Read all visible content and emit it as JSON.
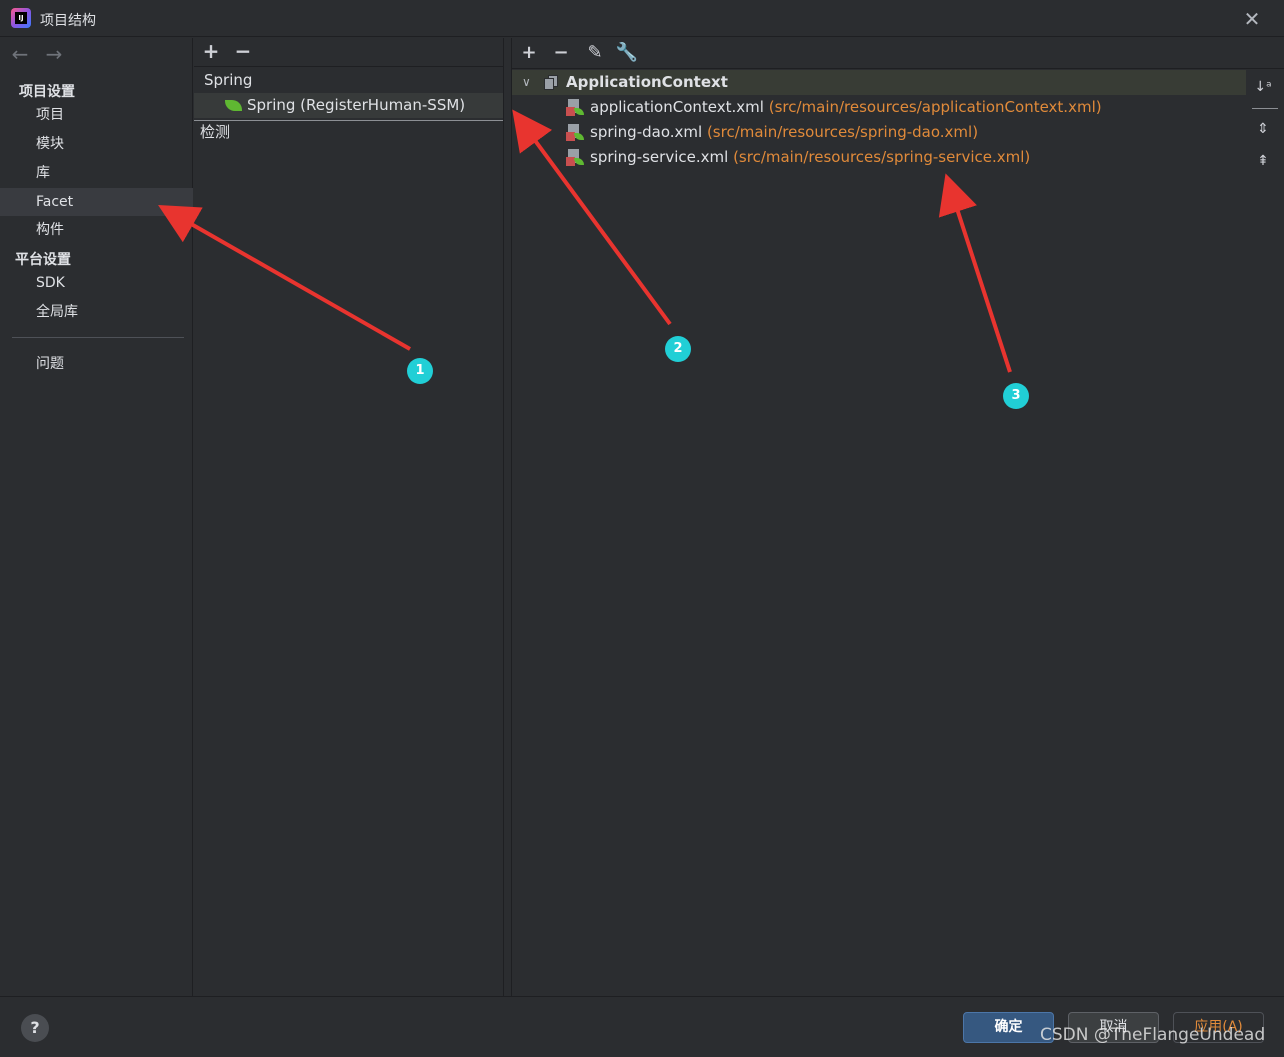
{
  "window": {
    "title": "项目结构",
    "app_icon_label": "IJ"
  },
  "left_nav": {
    "back_icon": "arrow-left-icon",
    "forward_icon": "arrow-right-icon",
    "project_settings_header": "项目设置",
    "project_items": [
      "项目",
      "模块",
      "库",
      "Facet",
      "构件"
    ],
    "platform_settings_header": "平台设置",
    "platform_items": [
      "SDK",
      "全局库"
    ],
    "problems": "问题",
    "selected": "Facet"
  },
  "middle": {
    "add_icon": "plus-icon",
    "remove_icon": "minus-icon",
    "group": "Spring",
    "facet": "Spring (RegisterHuman-SSM)",
    "detection": "检测"
  },
  "right": {
    "toolbar_icons": [
      "plus-icon",
      "minus-icon",
      "pencil-icon",
      "wrench-icon"
    ],
    "root": "ApplicationContext",
    "files": [
      {
        "name": "applicationContext.xml",
        "path": "(src/main/resources/applicationContext.xml)"
      },
      {
        "name": "spring-dao.xml",
        "path": "(src/main/resources/spring-dao.xml)"
      },
      {
        "name": "spring-service.xml",
        "path": "(src/main/resources/spring-service.xml)"
      }
    ],
    "side_tools": [
      "sort-alpha-icon",
      "expand-all-icon",
      "collapse-all-icon"
    ]
  },
  "annotations": [
    "1",
    "2",
    "3"
  ],
  "footer": {
    "help": "?",
    "ok": "确定",
    "cancel": "取消",
    "apply": "应用(A)",
    "watermark": "CSDN @TheFlangeUndead"
  },
  "colors": {
    "accent_button": "#365880",
    "path_text": "#e08a3a",
    "selection": "#393b40",
    "arrow": "#e8342f",
    "marker": "#21cfd6"
  }
}
